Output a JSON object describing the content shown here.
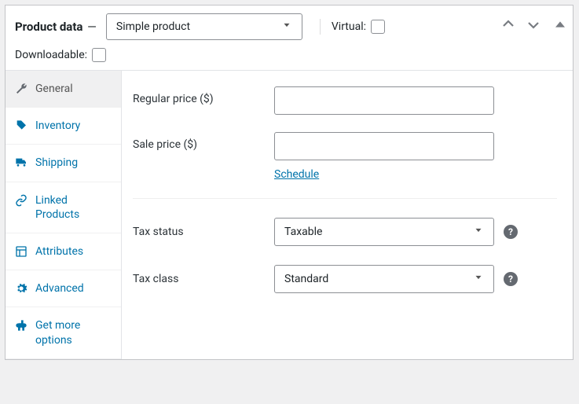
{
  "header": {
    "title": "Product data",
    "type_select": "Simple product",
    "virtual_label": "Virtual:",
    "downloadable_label": "Downloadable:"
  },
  "sidebar": {
    "tabs": [
      {
        "label": "General"
      },
      {
        "label": "Inventory"
      },
      {
        "label": "Shipping"
      },
      {
        "label": "Linked Products"
      },
      {
        "label": "Attributes"
      },
      {
        "label": "Advanced"
      },
      {
        "label": "Get more options"
      }
    ]
  },
  "fields": {
    "regular_price_label": "Regular price ($)",
    "sale_price_label": "Sale price ($)",
    "schedule_link": "Schedule",
    "tax_status_label": "Tax status",
    "tax_status_value": "Taxable",
    "tax_class_label": "Tax class",
    "tax_class_value": "Standard"
  },
  "help_char": "?"
}
